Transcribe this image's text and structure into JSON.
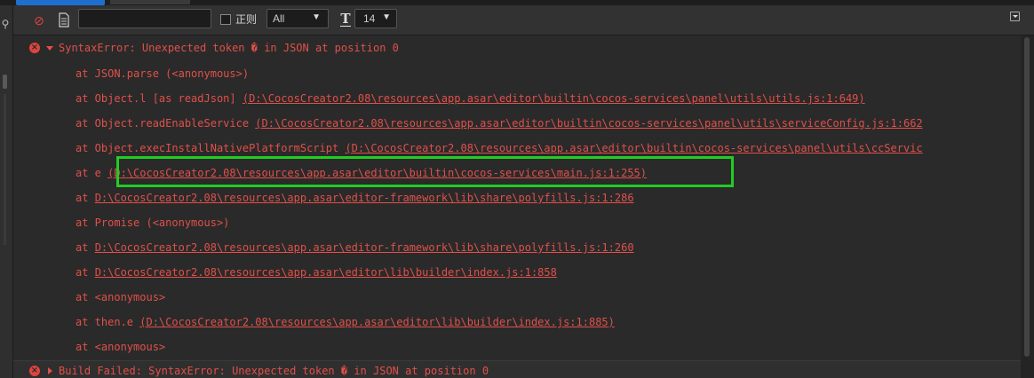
{
  "toolbar": {
    "filter_value": "",
    "regex_label": "正则",
    "level_selected": "All",
    "font_size_selected": "14"
  },
  "log": {
    "error_title": "SyntaxError: Unexpected token � in JSON at position 0",
    "stack": [
      {
        "prefix": "at JSON.parse (<anonymous>)",
        "link": ""
      },
      {
        "prefix": "at Object.l [as readJson]  ",
        "link": "(D:\\CocosCreator2.08\\resources\\app.asar\\editor\\builtin\\cocos-services\\panel\\utils\\utils.js:1:649)"
      },
      {
        "prefix": "at Object.readEnableService  ",
        "link": "(D:\\CocosCreator2.08\\resources\\app.asar\\editor\\builtin\\cocos-services\\panel\\utils\\serviceConfig.js:1:662"
      },
      {
        "prefix": "at Object.execInstallNativePlatformScript  ",
        "link": "(D:\\CocosCreator2.08\\resources\\app.asar\\editor\\builtin\\cocos-services\\panel\\utils\\ccServic"
      },
      {
        "prefix": "at e  ",
        "link": "(D:\\CocosCreator2.08\\resources\\app.asar\\editor\\builtin\\cocos-services\\main.js:1:255)"
      },
      {
        "prefix": "at  ",
        "link": "D:\\CocosCreator2.08\\resources\\app.asar\\editor-framework\\lib\\share\\polyfills.js:1:286"
      },
      {
        "prefix": "at Promise (<anonymous>)",
        "link": ""
      },
      {
        "prefix": "at  ",
        "link": "D:\\CocosCreator2.08\\resources\\app.asar\\editor-framework\\lib\\share\\polyfills.js:1:260"
      },
      {
        "prefix": "at  ",
        "link": "D:\\CocosCreator2.08\\resources\\app.asar\\editor\\lib\\builder\\index.js:1:858"
      },
      {
        "prefix": "at <anonymous>",
        "link": ""
      },
      {
        "prefix": "at then.e  ",
        "link": "(D:\\CocosCreator2.08\\resources\\app.asar\\editor\\lib\\builder\\index.js:1:885)"
      },
      {
        "prefix": "at <anonymous>",
        "link": ""
      }
    ],
    "build_failed": "Build Failed: SyntaxError: Unexpected token � in JSON at position 0"
  },
  "colors": {
    "error_text": "#e0504a",
    "highlight_box": "#22cc22",
    "background": "#2a2a2a"
  }
}
